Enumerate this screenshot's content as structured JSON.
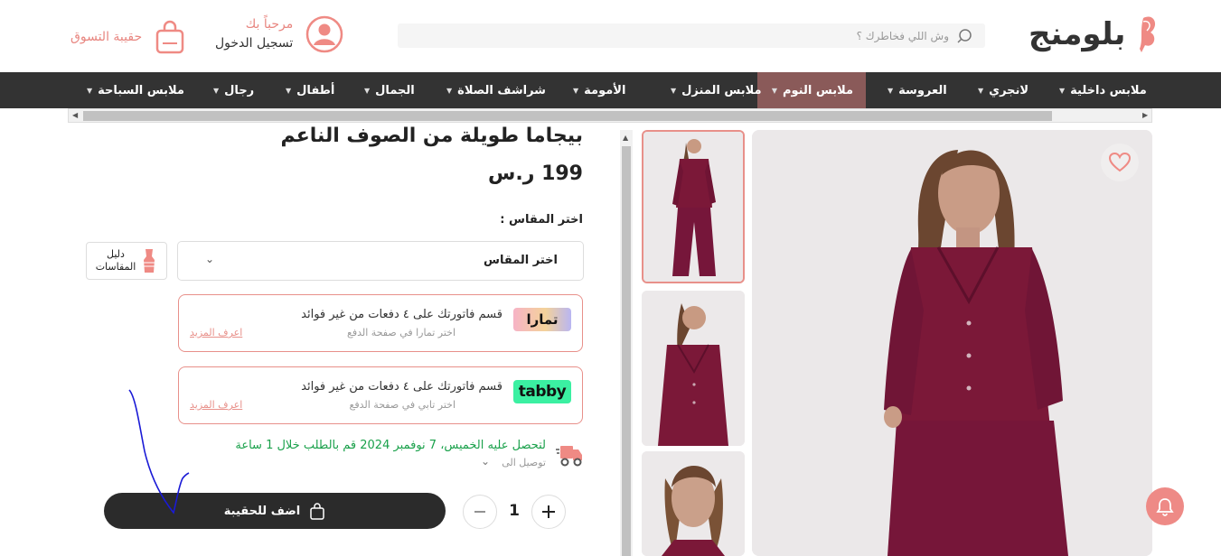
{
  "header": {
    "logo_text": "بلومنج",
    "search_placeholder": "وش اللي فخاطرك ؟",
    "account_welcome": "مرحباً بك",
    "account_login": "تسجيل الدخول",
    "bag_label": "حقيبة التسوق"
  },
  "nav": {
    "items": [
      {
        "label": "ملابس داخلية"
      },
      {
        "label": "لانجري"
      },
      {
        "label": "العروسة"
      },
      {
        "label": "ملابس النوم",
        "active": true
      },
      {
        "label": "ملابس المنزل"
      },
      {
        "label": "الأمومة"
      },
      {
        "label": "شراشف الصلاة"
      },
      {
        "label": "الجمال"
      },
      {
        "label": "أطفال"
      },
      {
        "label": "رجال"
      },
      {
        "label": "ملابس السباحة"
      }
    ]
  },
  "product": {
    "title": "بيجاما طويلة من الصوف الناعم",
    "price": "199 ر.س",
    "size_label": "اختر المقاس :",
    "size_select_value": "اختر المقاس",
    "size_guide_line1": "دليل",
    "size_guide_line2": "المقاسات"
  },
  "payments": [
    {
      "logo": "تمارا",
      "main": "قسم فاتورتك على ٤ دفعات من غير فوائد",
      "sub": "اختر تمارا في صفحة الدفع",
      "more": "اعرف المزيد"
    },
    {
      "logo": "tabby",
      "main": "قسم فاتورتك على ٤ دفعات من غير فوائد",
      "sub": "اختر تابي في صفحة الدفع",
      "more": "اعرف المزيد"
    }
  ],
  "delivery": {
    "text": "لتحصل عليه الخميس، 7 نوفمبر 2024 قم بالطلب خلال 1 ساعة",
    "to": "توصيل الى"
  },
  "cart": {
    "quantity": "1",
    "add_label": "اضف للحقيبة"
  },
  "colors": {
    "accent": "#e8908a",
    "nav_bg": "#333333",
    "nav_active": "#8a5a59",
    "delivery_green": "#1aa14b",
    "button_dark": "#2b2b2b",
    "product_color": "#7b1838"
  },
  "icons": [
    "search-icon",
    "user-icon",
    "shopping-bag-icon",
    "heart-icon",
    "bell-icon",
    "truck-icon",
    "size-guide-icon",
    "chevron-down-icon",
    "plus-icon",
    "minus-icon"
  ]
}
